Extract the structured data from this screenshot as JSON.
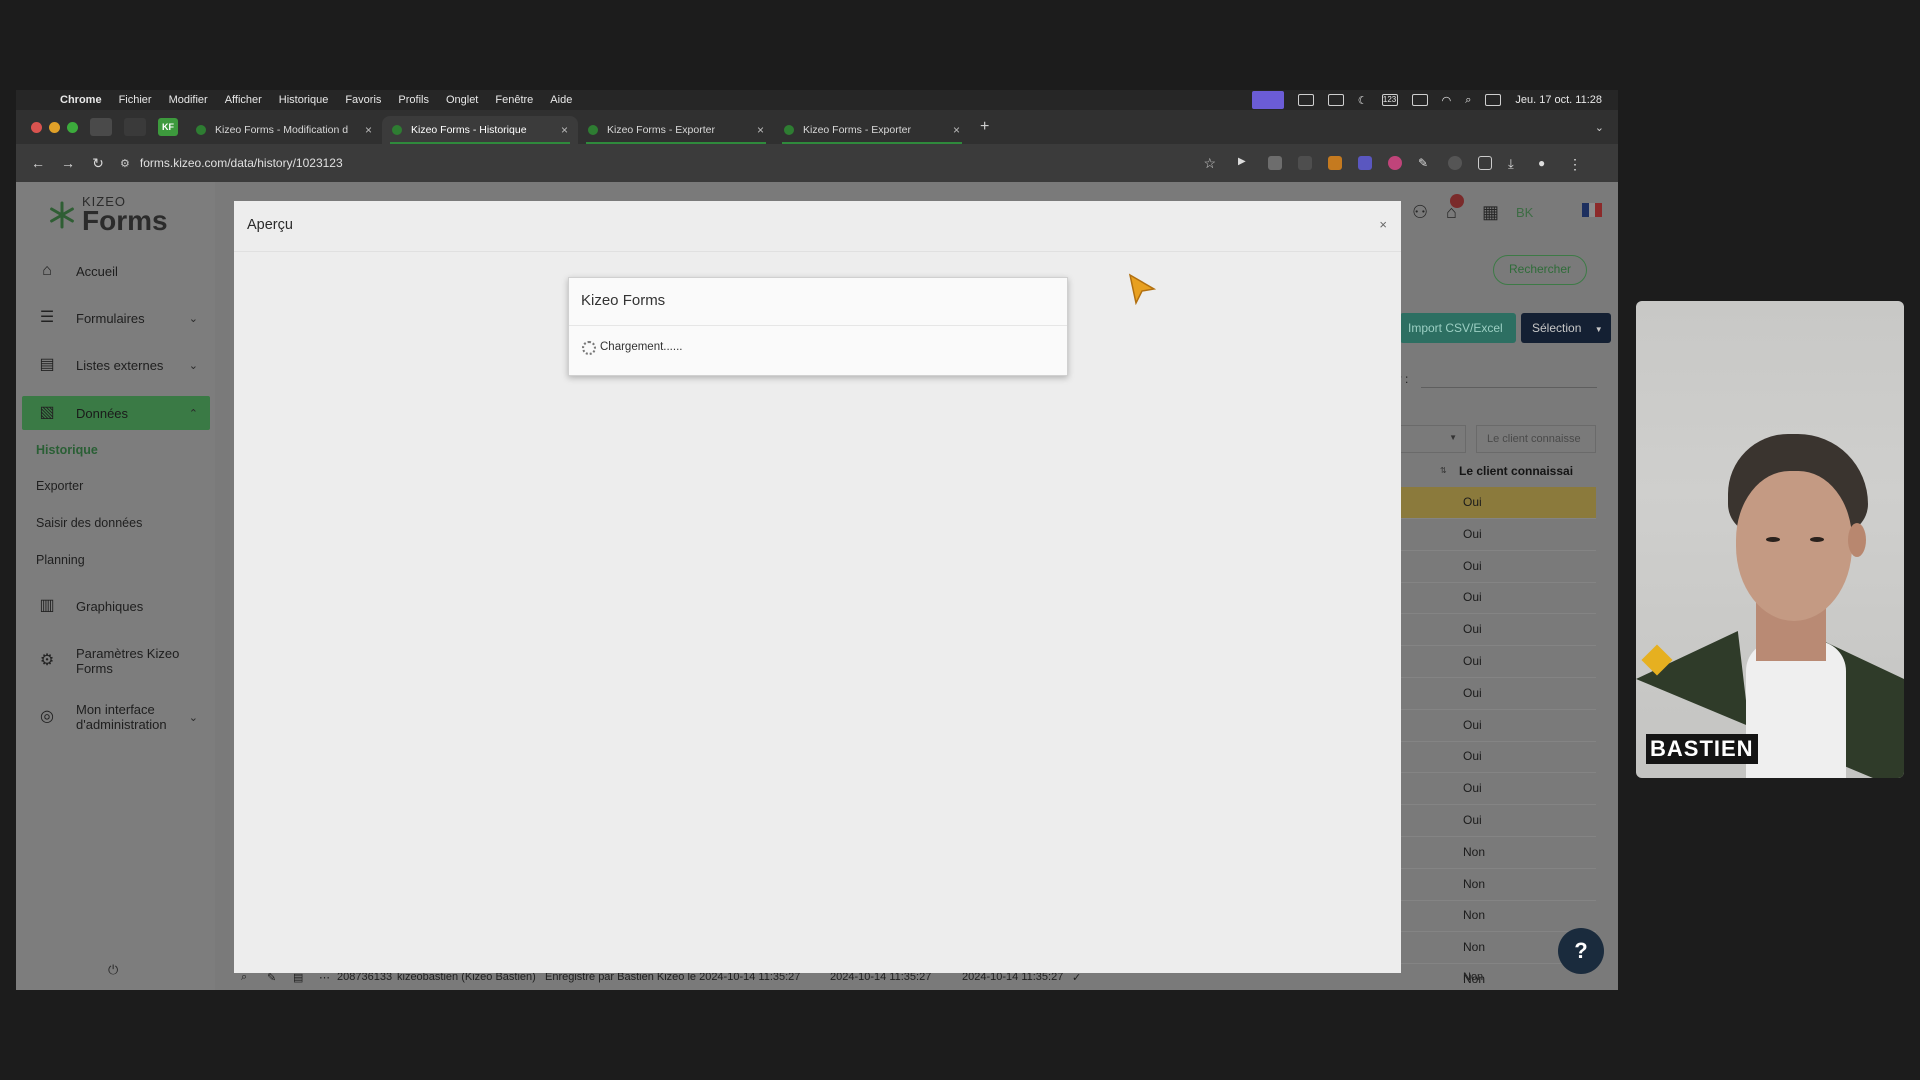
{
  "menubar": {
    "app": "Chrome",
    "items": [
      "Fichier",
      "Modifier",
      "Afficher",
      "Historique",
      "Favoris",
      "Profils",
      "Onglet",
      "Fenêtre",
      "Aide"
    ],
    "clock": "Jeu. 17 oct.  11:28"
  },
  "browser": {
    "pinned_badge": "KF",
    "tabs": [
      {
        "label": "Kizeo Forms - Modification d",
        "active": false
      },
      {
        "label": "Kizeo Forms - Historique",
        "active": true
      },
      {
        "label": "Kizeo Forms - Exporter",
        "active": false
      },
      {
        "label": "Kizeo Forms - Exporter",
        "active": false
      }
    ],
    "url": "forms.kizeo.com/data/history/1023123"
  },
  "app": {
    "logo_top": "KIZEO",
    "logo_bottom": "Forms",
    "user_initials": "BK",
    "search_button": "Rechercher",
    "import_button": "Import CSV/Excel",
    "selection_button": "Sélection",
    "filter_label_fragment": "er :",
    "filter_placeholder": "Le client connaisse",
    "column_header": "Le client connaissai"
  },
  "sidebar": {
    "items": [
      {
        "label": "Accueil",
        "icon": "home-icon"
      },
      {
        "label": "Formulaires",
        "icon": "list-icon"
      },
      {
        "label": "Listes externes",
        "icon": "table-icon"
      },
      {
        "label": "Données",
        "icon": "document-icon"
      },
      {
        "label": "Graphiques",
        "icon": "chart-icon"
      },
      {
        "label": "Paramètres Kizeo Forms",
        "icon": "gear-icon"
      },
      {
        "label": "Mon interface d'administration",
        "icon": "user-circle-icon"
      }
    ],
    "sub_items": [
      "Historique",
      "Exporter",
      "Saisir des données",
      "Planning"
    ]
  },
  "table": {
    "values": [
      "Oui",
      "Oui",
      "Oui",
      "Oui",
      "Oui",
      "Oui",
      "Oui",
      "Oui",
      "Oui",
      "Oui",
      "Oui",
      "Non",
      "Non",
      "Non",
      "Non",
      "Non"
    ]
  },
  "bottom_row": {
    "id": "208736133",
    "user": "kizeobastien (Kizeo Bastien)",
    "note": "Enregistré par Bastien Kizeo le 2024-10-14 11:35:27",
    "date1": "2024-10-14 11:35:27",
    "date2": "2024-10-14 11:35:27",
    "value": "Non"
  },
  "modal": {
    "title": "Aperçu",
    "close": "×",
    "box_title": "Kizeo Forms",
    "loading_text": "Chargement......"
  },
  "webcam": {
    "name": "BASTIEN"
  },
  "colors": {
    "accent_green": "#3a7a45",
    "modal_bg": "#ededed",
    "cursor_orange": "#e8a020"
  }
}
